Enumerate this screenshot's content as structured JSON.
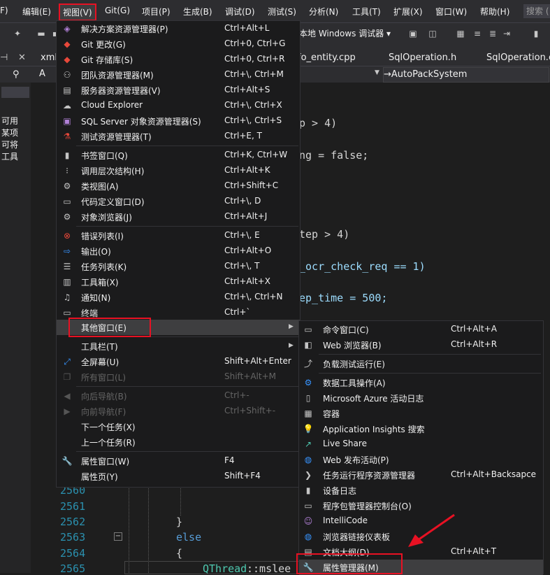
{
  "menubar": {
    "items": [
      "F)",
      "编辑(E)",
      "视图(V)",
      "Git(G)",
      "项目(P)",
      "生成(B)",
      "调试(D)",
      "测试(S)",
      "分析(N)",
      "工具(T)",
      "扩展(X)",
      "窗口(W)",
      "帮助(H)"
    ],
    "search_placeholder": "搜索 ("
  },
  "toolbar": {
    "debugger_label": "本地 Windows 调试器 ▾"
  },
  "tabs": [
    "xml_",
    "fo_entity.cpp",
    "SqlOperation.h",
    "SqlOperation.cp"
  ],
  "nav": {
    "member_dropdown": "→AutoPackSystem",
    "left_dropdown": "A"
  },
  "left_panel": {
    "lines": [
      "可用",
      "某项",
      "可将",
      "工具"
    ]
  },
  "editor": {
    "fragments": [
      "p > 4)",
      "ng = false;",
      "tep > 4)",
      "_ocr_check_req == 1)",
      "ep_time = 500;"
    ],
    "line_numbers": [
      "2560",
      "2561",
      "2562",
      "2563",
      "2564",
      "2565"
    ],
    "brace_close": "}",
    "else_kw": "else",
    "brace_open": "{",
    "bottom_code_type": "QThread",
    "bottom_code_rest": "::mslee"
  },
  "view_menu": {
    "items": [
      {
        "label": "解决方案资源管理器(P)",
        "shortcut": "Ctrl+Alt+L",
        "icon": "solution-explorer-icon"
      },
      {
        "label": "Git 更改(G)",
        "shortcut": "Ctrl+0, Ctrl+G",
        "icon": "git-changes-icon"
      },
      {
        "label": "Git 存储库(S)",
        "shortcut": "Ctrl+0, Ctrl+R",
        "icon": "git-repo-icon"
      },
      {
        "label": "团队资源管理器(M)",
        "shortcut": "Ctrl+\\, Ctrl+M",
        "icon": "team-explorer-icon"
      },
      {
        "label": "服务器资源管理器(V)",
        "shortcut": "Ctrl+Alt+S",
        "icon": "server-explorer-icon"
      },
      {
        "label": "Cloud Explorer",
        "shortcut": "Ctrl+\\, Ctrl+X",
        "icon": "cloud-icon"
      },
      {
        "label": "SQL Server 对象资源管理器(S)",
        "shortcut": "Ctrl+\\, Ctrl+S",
        "icon": "sql-server-icon"
      },
      {
        "label": "测试资源管理器(T)",
        "shortcut": "Ctrl+E, T",
        "icon": "test-explorer-icon"
      },
      {
        "label": "书签窗口(Q)",
        "shortcut": "Ctrl+K, Ctrl+W",
        "icon": "bookmark-icon"
      },
      {
        "label": "调用层次结构(H)",
        "shortcut": "Ctrl+Alt+K",
        "icon": "call-hierarchy-icon"
      },
      {
        "label": "类视图(A)",
        "shortcut": "Ctrl+Shift+C",
        "icon": "class-view-icon"
      },
      {
        "label": "代码定义窗口(D)",
        "shortcut": "Ctrl+\\, D",
        "icon": "code-definition-icon"
      },
      {
        "label": "对象浏览器(J)",
        "shortcut": "Ctrl+Alt+J",
        "icon": "object-browser-icon"
      },
      {
        "label": "错误列表(I)",
        "shortcut": "Ctrl+\\, E",
        "icon": "error-list-icon"
      },
      {
        "label": "输出(O)",
        "shortcut": "Ctrl+Alt+O",
        "icon": "output-icon"
      },
      {
        "label": "任务列表(K)",
        "shortcut": "Ctrl+\\, T",
        "icon": "task-list-icon"
      },
      {
        "label": "工具箱(X)",
        "shortcut": "Ctrl+Alt+X",
        "icon": "toolbox-icon"
      },
      {
        "label": "通知(N)",
        "shortcut": "Ctrl+\\, Ctrl+N",
        "icon": "bell-icon"
      },
      {
        "label": "终端",
        "shortcut": "Ctrl+`",
        "icon": "terminal-icon"
      },
      {
        "label": "其他窗口(E)",
        "shortcut": "",
        "icon": ""
      },
      {
        "label": "工具栏(T)",
        "shortcut": "",
        "icon": ""
      },
      {
        "label": "全屏幕(U)",
        "shortcut": "Shift+Alt+Enter",
        "icon": "fullscreen-icon"
      },
      {
        "label": "所有窗口(L)",
        "shortcut": "Shift+Alt+M",
        "icon": "all-windows-icon"
      },
      {
        "label": "向后导航(B)",
        "shortcut": "Ctrl+-",
        "icon": "navigate-back-icon"
      },
      {
        "label": "向前导航(F)",
        "shortcut": "Ctrl+Shift+-",
        "icon": "navigate-forward-icon"
      },
      {
        "label": "下一个任务(X)",
        "shortcut": "",
        "icon": ""
      },
      {
        "label": "上一个任务(R)",
        "shortcut": "",
        "icon": ""
      },
      {
        "label": "属性窗口(W)",
        "shortcut": "F4",
        "icon": "wrench-icon"
      },
      {
        "label": "属性页(Y)",
        "shortcut": "Shift+F4",
        "icon": ""
      }
    ]
  },
  "other_windows_menu": {
    "items": [
      {
        "label": "命令窗口(C)",
        "shortcut": "Ctrl+Alt+A",
        "icon": "command-window-icon"
      },
      {
        "label": "Web 浏览器(B)",
        "shortcut": "Ctrl+Alt+R",
        "icon": "web-browser-icon"
      },
      {
        "label": "负载测试运行(E)",
        "shortcut": "",
        "icon": "load-test-icon"
      },
      {
        "label": "数据工具操作(A)",
        "shortcut": "",
        "icon": "data-tools-icon"
      },
      {
        "label": "Microsoft Azure 活动日志",
        "shortcut": "",
        "icon": "azure-log-icon"
      },
      {
        "label": "容器",
        "shortcut": "",
        "icon": "container-icon"
      },
      {
        "label": "Application Insights 搜索",
        "shortcut": "",
        "icon": "app-insights-icon"
      },
      {
        "label": "Live Share",
        "shortcut": "",
        "icon": "live-share-icon"
      },
      {
        "label": "Web 发布活动(P)",
        "shortcut": "",
        "icon": "web-publish-icon"
      },
      {
        "label": "任务运行程序资源管理器",
        "shortcut": "Ctrl+Alt+Backsapce",
        "icon": "task-runner-icon"
      },
      {
        "label": "设备日志",
        "shortcut": "",
        "icon": "device-log-icon"
      },
      {
        "label": "程序包管理器控制台(O)",
        "shortcut": "",
        "icon": "package-console-icon"
      },
      {
        "label": "IntelliCode",
        "shortcut": "",
        "icon": "intellicode-icon"
      },
      {
        "label": "浏览器链接仪表板",
        "shortcut": "",
        "icon": "browser-link-icon"
      },
      {
        "label": "文档大纲(D)",
        "shortcut": "Ctrl+Alt+T",
        "icon": "document-outline-icon"
      },
      {
        "label": "属性管理器(M)",
        "shortcut": "",
        "icon": "wrench-icon"
      }
    ]
  },
  "colors": {
    "highlight_red": "#e81123",
    "menu_bg": "#1b1b1c",
    "hover_bg": "#3e3e40"
  }
}
